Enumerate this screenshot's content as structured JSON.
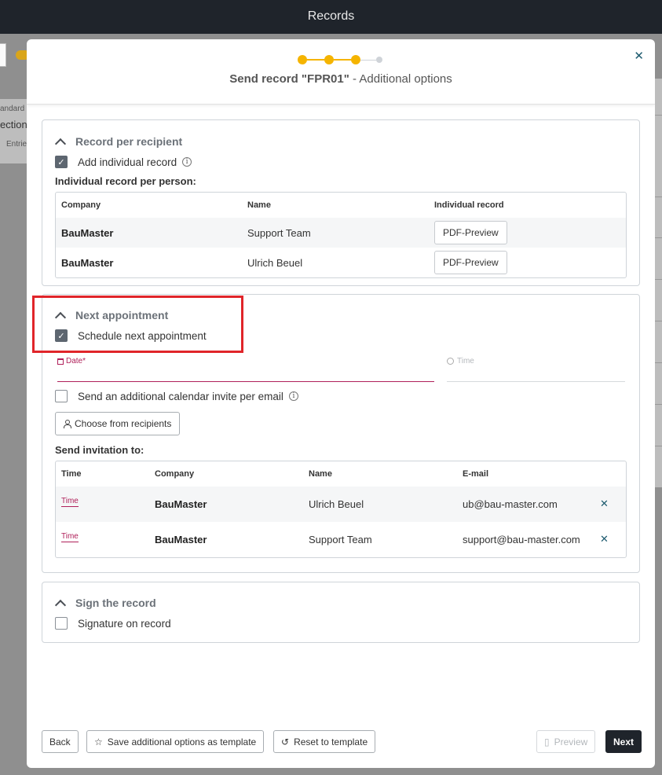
{
  "app": {
    "title": "Records"
  },
  "background": {
    "fragments": [
      "andard",
      "ection",
      "Entrie"
    ]
  },
  "dialog": {
    "title_bold": "Send record \"FPR01\"",
    "title_rest": " - Additional options",
    "steps": {
      "total": 4,
      "current": 3
    },
    "close_icon": "close-icon"
  },
  "record_per_recipient": {
    "heading": "Record per recipient",
    "add_individual_label": "Add individual record",
    "add_individual_checked": true,
    "sub_label": "Individual record per person:",
    "columns": [
      "Company",
      "Name",
      "Individual record"
    ],
    "rows": [
      {
        "company": "BauMaster",
        "name": "Support Team",
        "action": "PDF-Preview"
      },
      {
        "company": "BauMaster",
        "name": "Ulrich Beuel",
        "action": "PDF-Preview"
      }
    ]
  },
  "next_appointment": {
    "heading": "Next appointment",
    "schedule_label": "Schedule next appointment",
    "schedule_checked": true,
    "date_label": "Date*",
    "time_label": "Time",
    "calendar_invite_label": "Send an additional calendar invite per email",
    "calendar_invite_checked": false,
    "choose_button": "Choose from recipients",
    "invite_label": "Send invitation to:",
    "columns": [
      "Time",
      "Company",
      "Name",
      "E-mail"
    ],
    "rows": [
      {
        "time": "Time",
        "company": "BauMaster",
        "name": "Ulrich Beuel",
        "email": "ub@bau-master.com"
      },
      {
        "time": "Time",
        "company": "BauMaster",
        "name": "Support Team",
        "email": "support@bau-master.com"
      }
    ]
  },
  "sign_record": {
    "heading": "Sign the record",
    "signature_label": "Signature on record",
    "signature_checked": false
  },
  "footer": {
    "back": "Back",
    "save_template": "Save additional options as template",
    "reset_template": "Reset to template",
    "preview": "Preview",
    "next": "Next"
  },
  "colors": {
    "topbar": "#1f242b",
    "accent_yellow": "#f5b400",
    "required_red": "#b0205a",
    "highlight": "#e0252a"
  }
}
